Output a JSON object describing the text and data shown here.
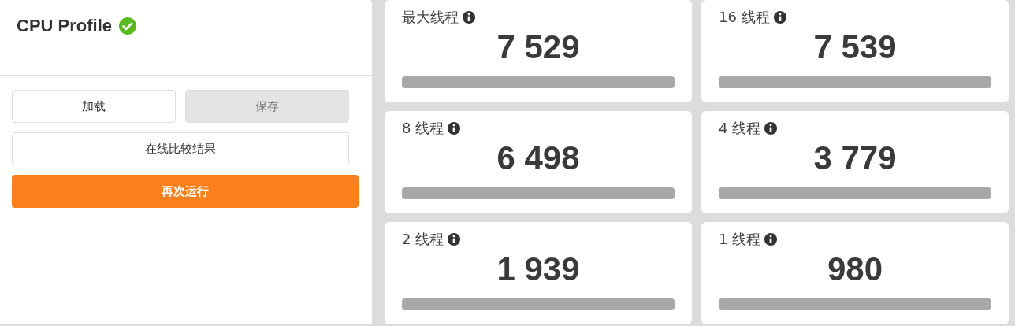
{
  "profile": {
    "title": "CPU Profile",
    "verified": true,
    "buttons": [
      {
        "label": "加载",
        "kind": "plain",
        "disabled": false
      },
      {
        "label": "保存",
        "kind": "plain",
        "disabled": true
      },
      {
        "label": "在线比较结果",
        "kind": "wide",
        "disabled": false
      },
      {
        "label": "再次运行",
        "kind": "primary",
        "disabled": false
      }
    ]
  },
  "scores": [
    {
      "label": "最大线程",
      "value": "7 529"
    },
    {
      "label": "16 线程",
      "value": "7 539"
    },
    {
      "label": "8 线程",
      "value": "6 498"
    },
    {
      "label": "4 线程",
      "value": "3 779"
    },
    {
      "label": "2 线程",
      "value": "1 939"
    },
    {
      "label": "1 线程",
      "value": "980"
    }
  ]
}
